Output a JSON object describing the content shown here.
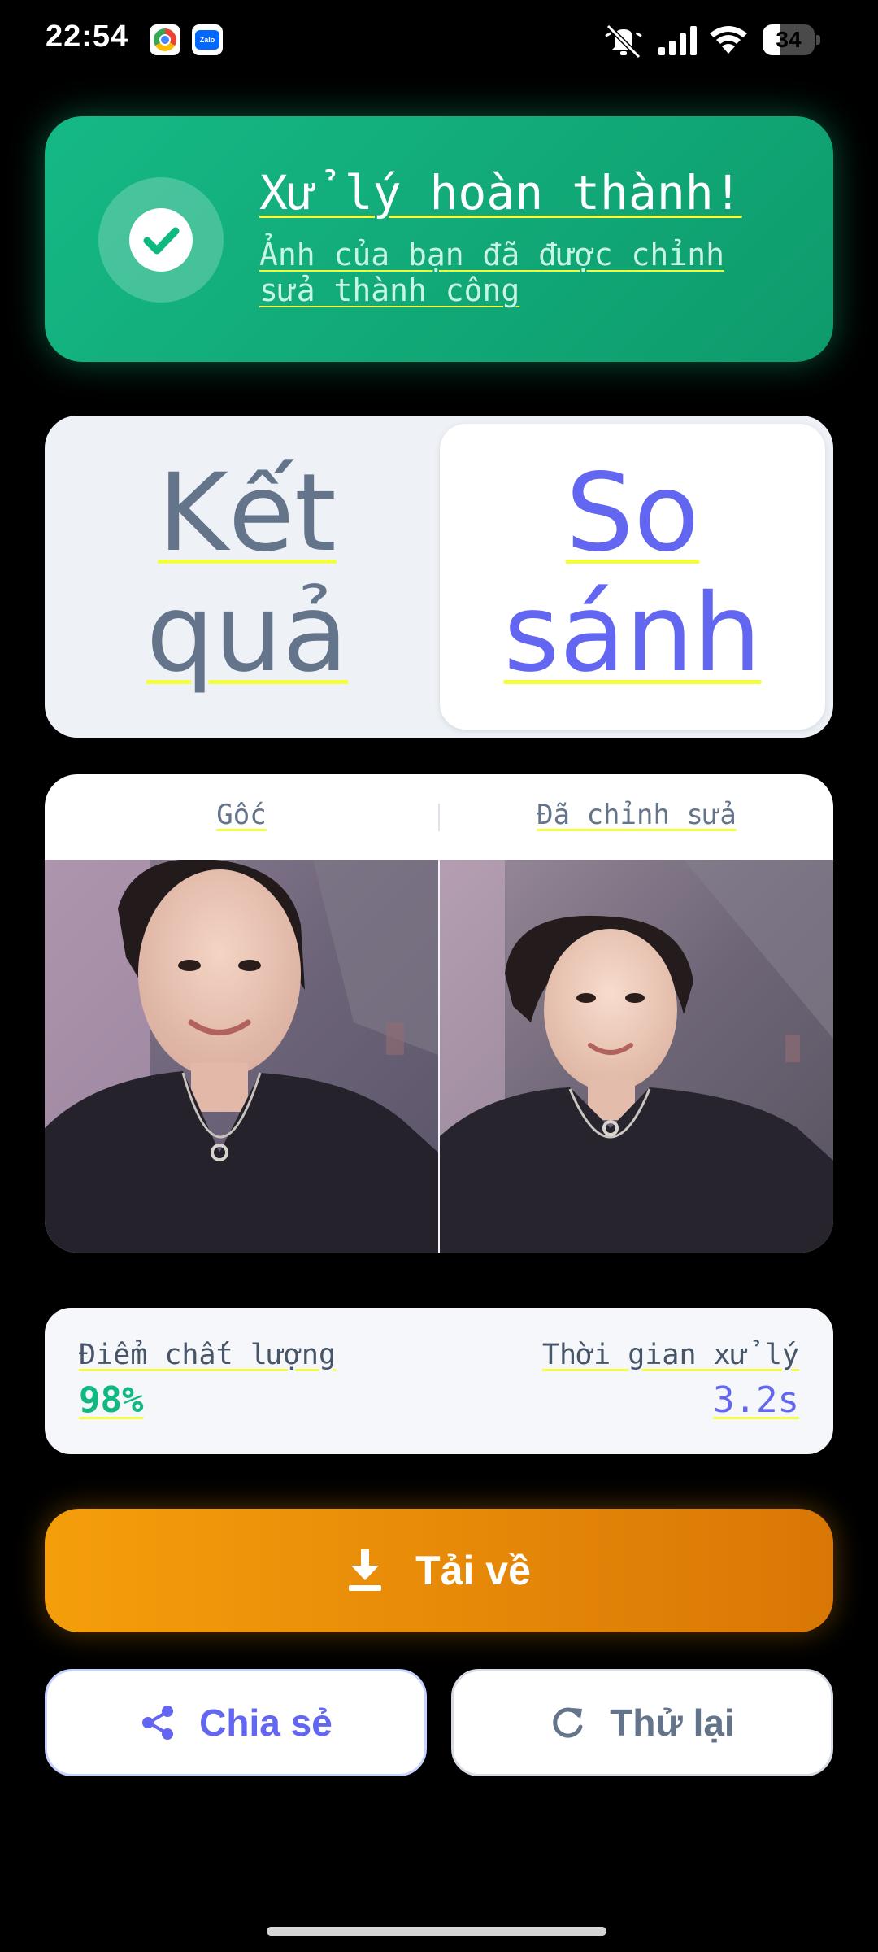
{
  "status_bar": {
    "time": "22:54",
    "battery_level": "34",
    "battery_fraction": 0.34,
    "icons": [
      "chrome-icon",
      "zalo-icon",
      "mute-icon",
      "signal-icon",
      "wifi-icon",
      "battery-icon"
    ],
    "zalo_badge_text": "Zalo"
  },
  "success": {
    "title": "Xử lý hoàn thành!",
    "subtitle": "Ảnh của bạn đã được chỉnh sửa thành công",
    "icon": "check-circle-icon",
    "accent_color": "#10b981"
  },
  "tabs": {
    "result_label": "Kết quả",
    "compare_label": "So sánh",
    "active": "compare",
    "active_color": "#6366f1"
  },
  "compare": {
    "original_label": "Gốc",
    "edited_label": "Đã chỉnh sửa"
  },
  "stats": {
    "quality_label": "Điểm chất lượng",
    "quality_value": "98%",
    "time_label": "Thời gian xử lý",
    "time_value": "3.2s"
  },
  "actions": {
    "download_label": "Tải về",
    "download_icon": "download-icon",
    "download_color": "#f59e0b",
    "share_label": "Chia sẻ",
    "share_icon": "share-icon",
    "retry_label": "Thử lại",
    "retry_icon": "refresh-icon"
  }
}
